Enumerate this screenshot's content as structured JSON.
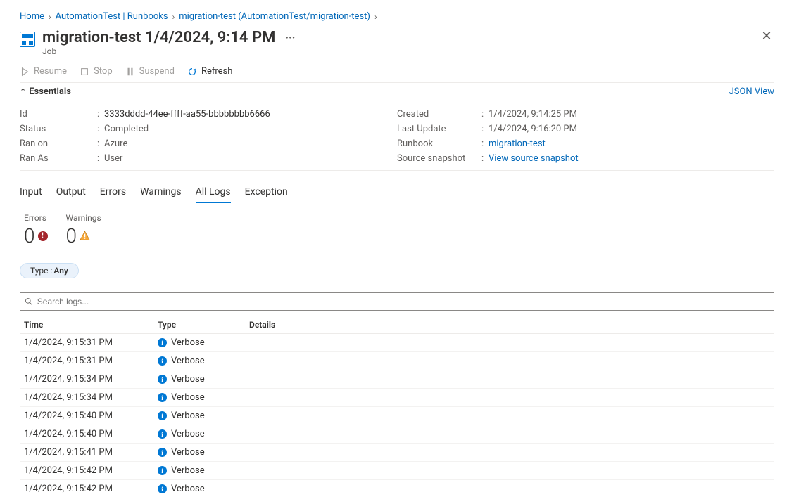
{
  "breadcrumb": {
    "home": "Home",
    "l2": "AutomationTest | Runbooks",
    "l3": "migration-test (AutomationTest/migration-test)"
  },
  "header": {
    "title": "migration-test 1/4/2024, 9:14 PM",
    "subtitle": "Job"
  },
  "toolbar": {
    "resume": "Resume",
    "stop": "Stop",
    "suspend": "Suspend",
    "refresh": "Refresh"
  },
  "essentials": {
    "heading": "Essentials",
    "json_view": "JSON View",
    "left": {
      "id_label": "Id",
      "id_value": "3333dddd-44ee-ffff-aa55-bbbbbbbb6666",
      "status_label": "Status",
      "status_value": "Completed",
      "ranon_label": "Ran on",
      "ranon_value": "Azure",
      "ranas_label": "Ran As",
      "ranas_value": "User"
    },
    "right": {
      "created_label": "Created",
      "created_value": "1/4/2024, 9:14:25 PM",
      "lastupdate_label": "Last Update",
      "lastupdate_value": "1/4/2024, 9:16:20 PM",
      "runbook_label": "Runbook",
      "runbook_value": "migration-test",
      "snapshot_label": "Source snapshot",
      "snapshot_value": "View source snapshot"
    }
  },
  "tabs": {
    "input": "Input",
    "output": "Output",
    "errors": "Errors",
    "warnings": "Warnings",
    "alllogs": "All Logs",
    "exception": "Exception"
  },
  "counters": {
    "errors_label": "Errors",
    "errors_value": "0",
    "warnings_label": "Warnings",
    "warnings_value": "0"
  },
  "filter": {
    "key": "Type :",
    "value": "Any"
  },
  "search": {
    "placeholder": "Search logs..."
  },
  "table": {
    "head_time": "Time",
    "head_type": "Type",
    "head_details": "Details",
    "rows": [
      {
        "time": "1/4/2024, 9:15:31 PM",
        "type": "Verbose"
      },
      {
        "time": "1/4/2024, 9:15:31 PM",
        "type": "Verbose"
      },
      {
        "time": "1/4/2024, 9:15:34 PM",
        "type": "Verbose"
      },
      {
        "time": "1/4/2024, 9:15:34 PM",
        "type": "Verbose"
      },
      {
        "time": "1/4/2024, 9:15:40 PM",
        "type": "Verbose"
      },
      {
        "time": "1/4/2024, 9:15:40 PM",
        "type": "Verbose"
      },
      {
        "time": "1/4/2024, 9:15:41 PM",
        "type": "Verbose"
      },
      {
        "time": "1/4/2024, 9:15:42 PM",
        "type": "Verbose"
      },
      {
        "time": "1/4/2024, 9:15:42 PM",
        "type": "Verbose"
      }
    ]
  }
}
